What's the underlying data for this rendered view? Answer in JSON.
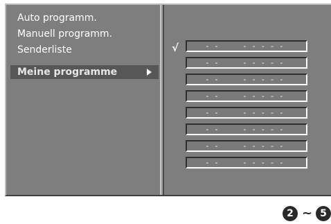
{
  "menu": {
    "items": [
      {
        "label": "Auto programm."
      },
      {
        "label": "Manuell programm."
      },
      {
        "label": "Senderliste"
      },
      {
        "label": "Meine programme",
        "selected": true
      }
    ]
  },
  "slots": {
    "check": "√",
    "items": [
      {
        "channel": "- -",
        "name": "- - - - -"
      },
      {
        "channel": "- -",
        "name": "- - - - -"
      },
      {
        "channel": "- -",
        "name": "- - - - -"
      },
      {
        "channel": "- -",
        "name": "- - - - -"
      },
      {
        "channel": "- -",
        "name": "- - - - -"
      },
      {
        "channel": "- -",
        "name": "- - - - -"
      },
      {
        "channel": "- -",
        "name": "- - - - -"
      },
      {
        "channel": "- -",
        "name": "- - - - -"
      }
    ]
  },
  "footer": {
    "start": "2",
    "separator": "~",
    "end": "5"
  }
}
